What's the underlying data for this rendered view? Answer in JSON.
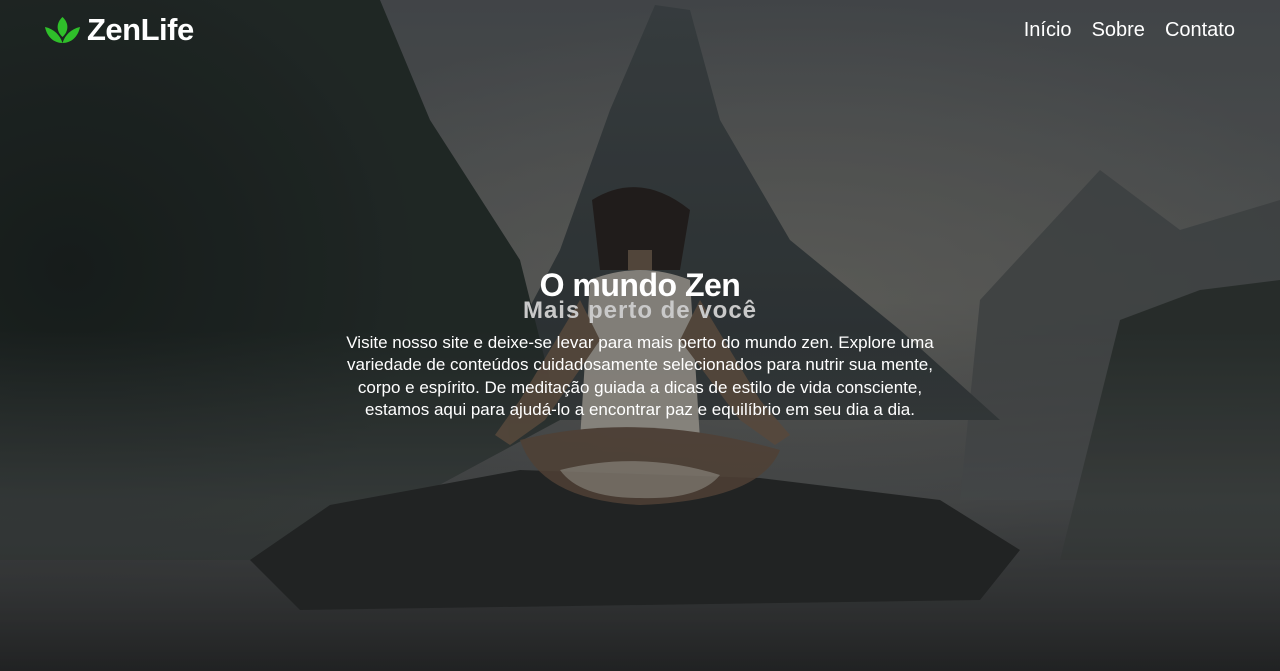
{
  "brand": {
    "name": "ZenLife",
    "logo_icon": "lotus-leaf-icon",
    "logo_color": "#2fbf2a"
  },
  "nav": {
    "items": [
      {
        "label": "Início"
      },
      {
        "label": "Sobre"
      },
      {
        "label": "Contato"
      }
    ]
  },
  "hero": {
    "title": "O mundo Zen",
    "subtitle": "Mais perto de você",
    "description": "Visite nosso site e deixe-se levar para mais perto do mundo zen. Explore uma variedade de conteúdos cuidadosamente selecionados para nutrir sua mente, corpo e espírito. De meditação guiada a dicas de estilo de vida consciente, estamos aqui para ajudá-lo a encontrar paz e equilíbrio em seu dia a dia.",
    "background_image": "woman-meditating-on-rock-before-misty-mountain"
  }
}
